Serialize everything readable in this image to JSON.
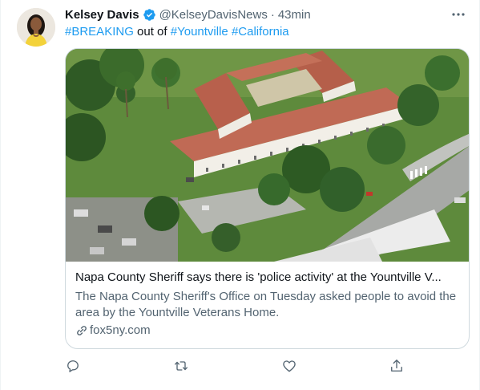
{
  "tweet": {
    "author_name": "Kelsey Davis",
    "author_handle": "@KelseyDavisNews",
    "separator": "·",
    "time": "43min",
    "text": {
      "hashtag1": "#BREAKING",
      "middle": " out of ",
      "hashtag2": "#Yountville",
      "space": " ",
      "hashtag3": "#California"
    }
  },
  "card": {
    "title": "Napa County Sheriff says there is 'police activity' at the Yountville V...",
    "description": "The Napa County Sheriff's Office on Tuesday asked people to avoid the area by the Yountville Veterans Home.",
    "domain": "fox5ny.com"
  },
  "icons": {
    "verified": "verified-badge-icon",
    "more": "more-horizontal-icon",
    "link": "link-icon",
    "reply": "reply-icon",
    "retweet": "retweet-icon",
    "like": "heart-icon",
    "share": "share-icon"
  },
  "colors": {
    "accent": "#1d9bf0",
    "secondary_text": "#536471",
    "border": "#cfd9de"
  }
}
